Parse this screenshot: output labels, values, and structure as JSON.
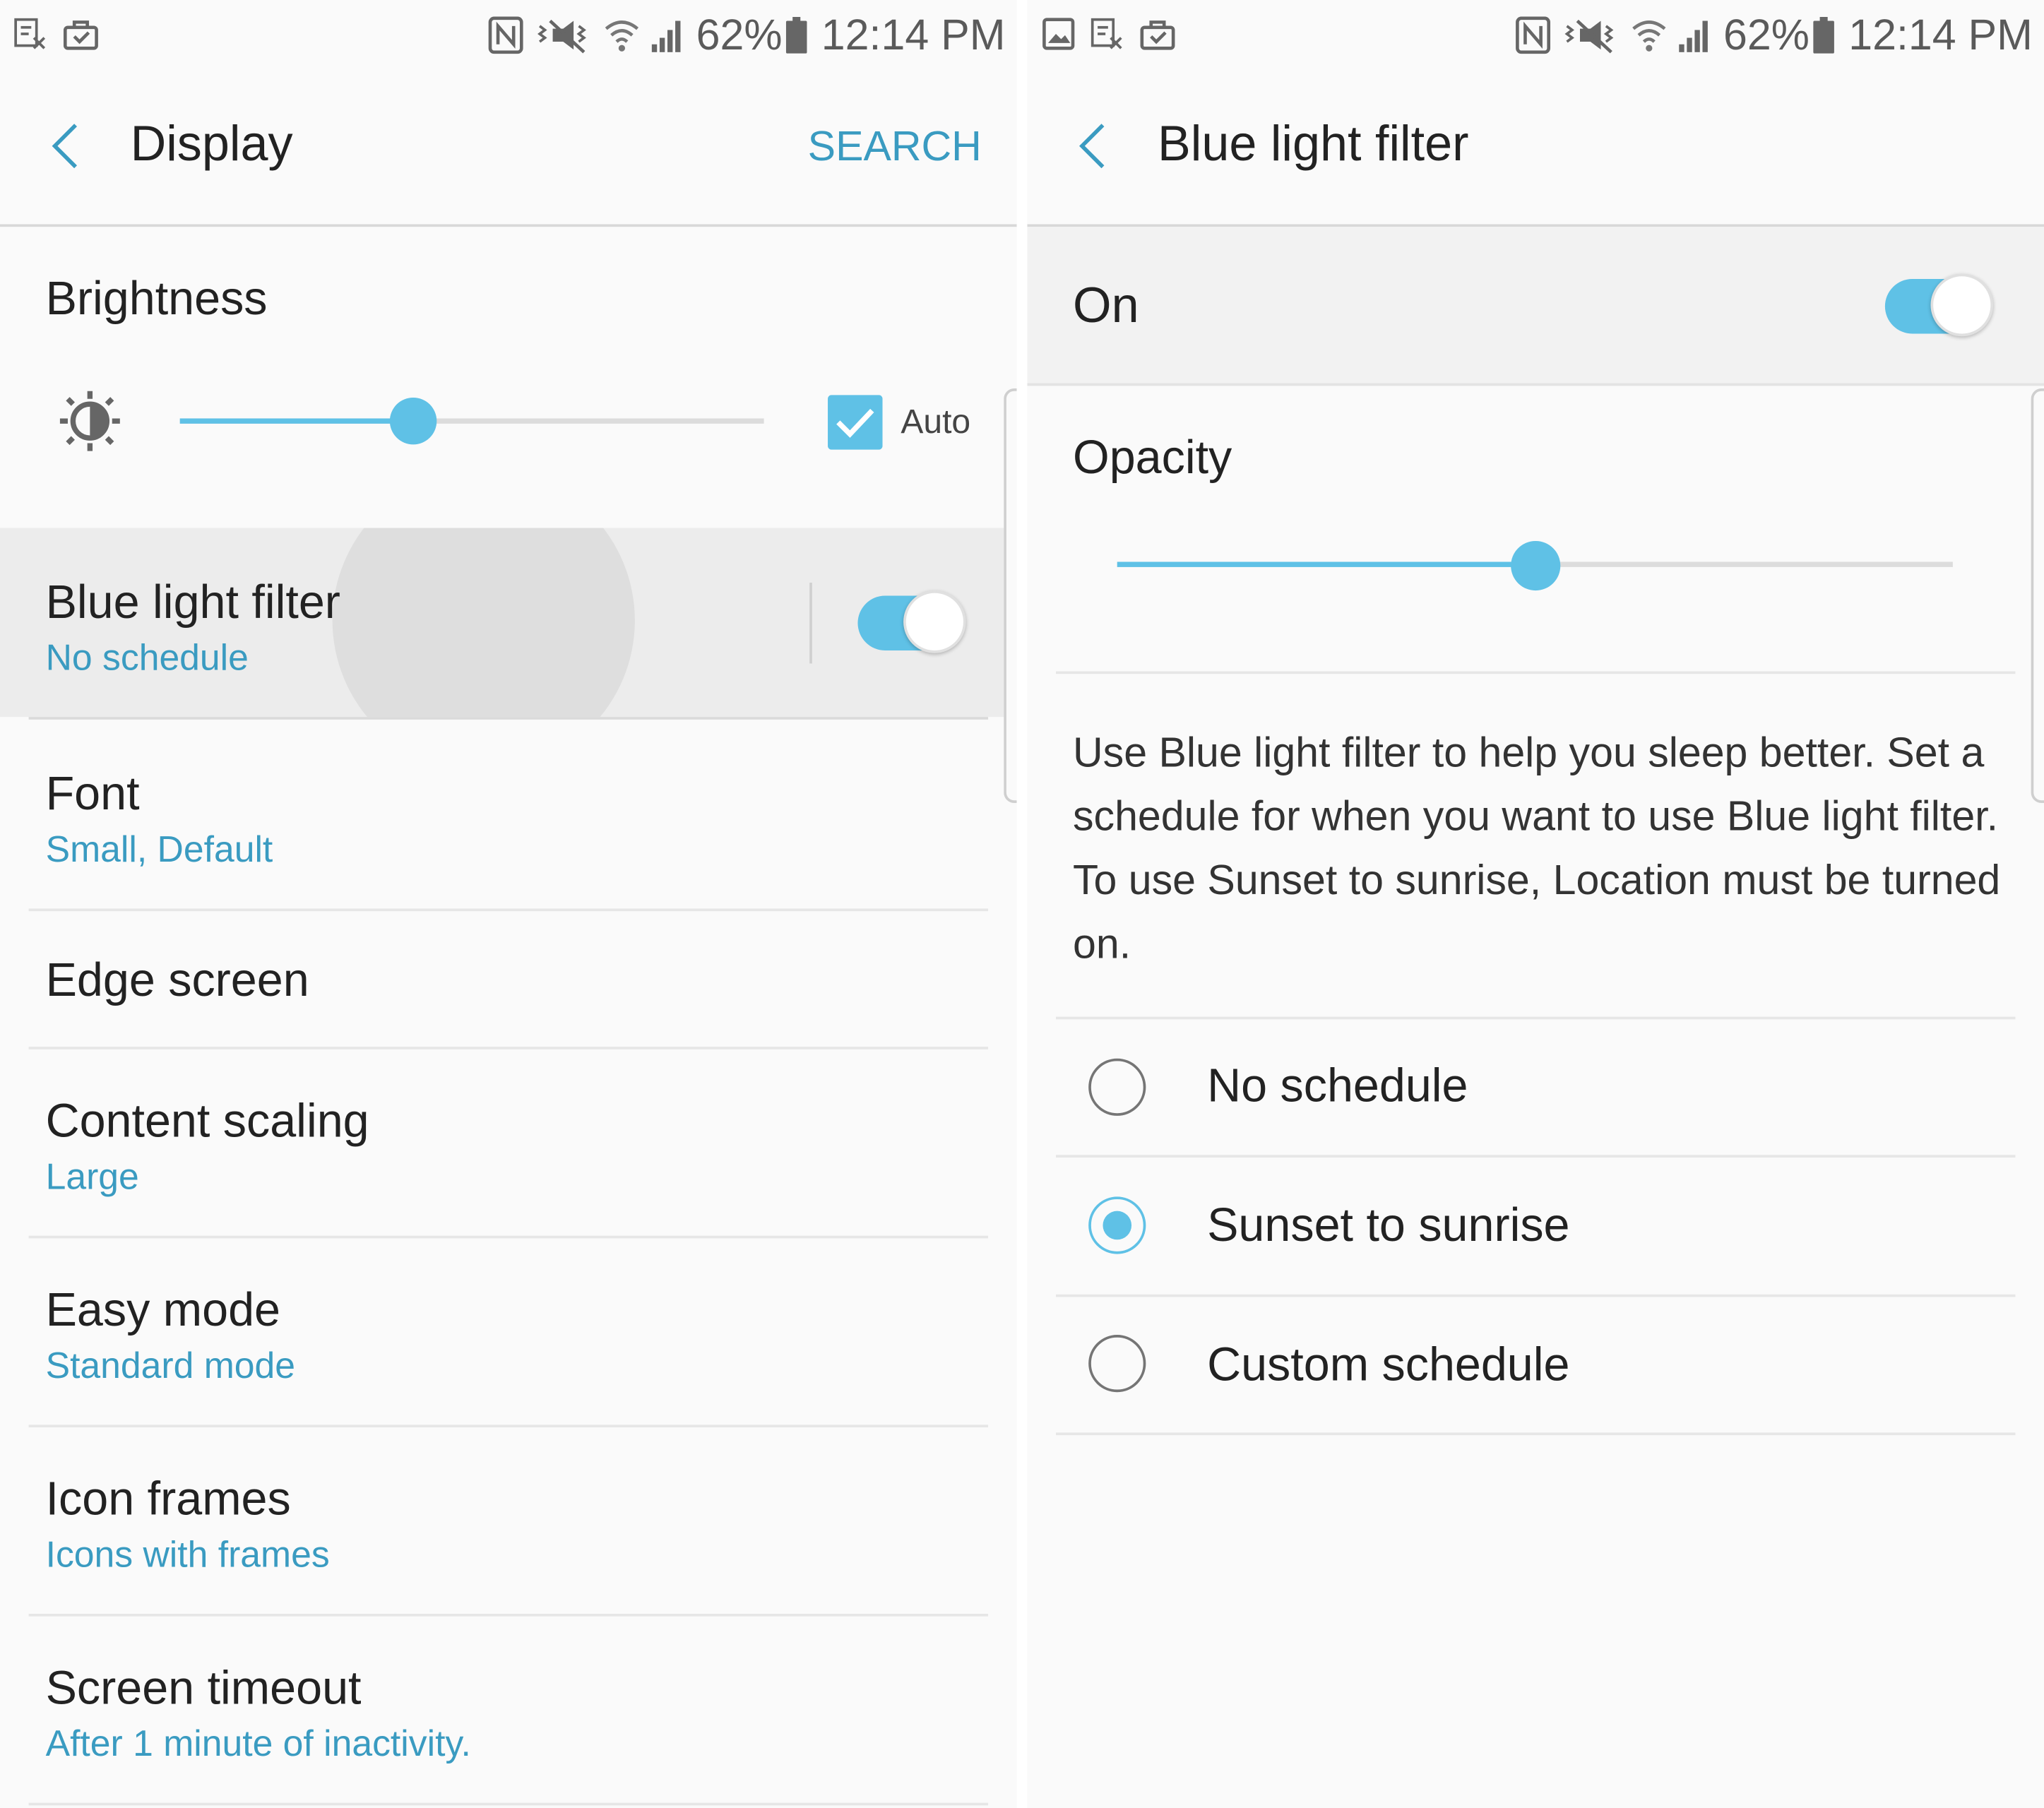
{
  "status_bar": {
    "battery": "62%",
    "time": "12:14 PM"
  },
  "display_screen": {
    "title": "Display",
    "search_label": "SEARCH",
    "brightness": {
      "title": "Brightness",
      "auto_label": "Auto",
      "auto_checked": true,
      "level": 0.4
    },
    "items": [
      {
        "title": "Blue light filter",
        "subtitle": "No schedule",
        "toggle_on": true
      },
      {
        "title": "Font",
        "subtitle": "Small, Default"
      },
      {
        "title": "Edge screen",
        "subtitle": ""
      },
      {
        "title": "Content scaling",
        "subtitle": "Large"
      },
      {
        "title": "Easy mode",
        "subtitle": "Standard mode"
      },
      {
        "title": "Icon frames",
        "subtitle": "Icons with frames"
      },
      {
        "title": "Screen timeout",
        "subtitle": "After 1 minute of inactivity."
      }
    ]
  },
  "blue_light_screen": {
    "title": "Blue light filter",
    "master_label": "On",
    "master_on": true,
    "opacity_label": "Opacity",
    "opacity_level": 0.5,
    "description": "Use Blue light filter to help you sleep better. Set a schedule for when you want to use Blue light filter. To use Sunset to sunrise, Location must be turned on.",
    "schedule_options": [
      {
        "label": "No schedule",
        "selected": false
      },
      {
        "label": "Sunset to sunrise",
        "selected": true
      },
      {
        "label": "Custom schedule",
        "selected": false
      }
    ]
  },
  "colors": {
    "accent": "#5fc1e6",
    "link": "#3a9bc1",
    "background": "#fafafa"
  }
}
